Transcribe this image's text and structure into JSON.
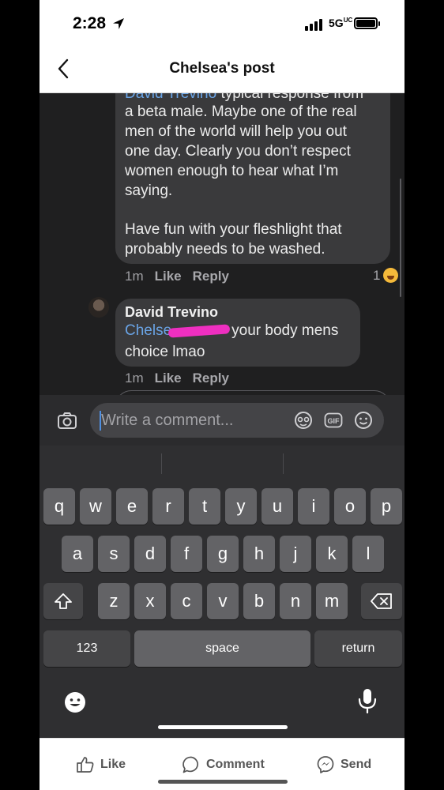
{
  "status_bar": {
    "time": "2:28",
    "network": "5G",
    "network_suffix": "UC"
  },
  "header": {
    "title": "Chelsea's post"
  },
  "thread": {
    "comment1": {
      "cut_mention": "David Trevino",
      "cut_text": " typical response from",
      "lines": [
        "a beta male. Maybe one of the real",
        "men of the world will help you out",
        "one day. Clearly you don’t respect",
        "women enough to hear what I’m",
        "saying.",
        "Have fun with your fleshlight that",
        "probably needs to be washed."
      ],
      "time": "1m",
      "like": "Like",
      "reply": "Reply",
      "reaction_count": "1"
    },
    "comment2": {
      "author": "David Trevino",
      "mention": "Chelse",
      "text_rest": "your body mens",
      "text_line2": "choice lmao",
      "time": "1m",
      "like": "Like",
      "reply": "Reply"
    }
  },
  "composer": {
    "placeholder": "Write a comment...",
    "gif": "GIF"
  },
  "keyboard": {
    "row1": [
      "q",
      "w",
      "e",
      "r",
      "t",
      "y",
      "u",
      "i",
      "o",
      "p"
    ],
    "row2": [
      "a",
      "s",
      "d",
      "f",
      "g",
      "h",
      "j",
      "k",
      "l"
    ],
    "row3": [
      "z",
      "x",
      "c",
      "v",
      "b",
      "n",
      "m"
    ],
    "numbers": "123",
    "space": "space",
    "return": "return"
  },
  "actions": {
    "like": "Like",
    "comment": "Comment",
    "send": "Send"
  }
}
